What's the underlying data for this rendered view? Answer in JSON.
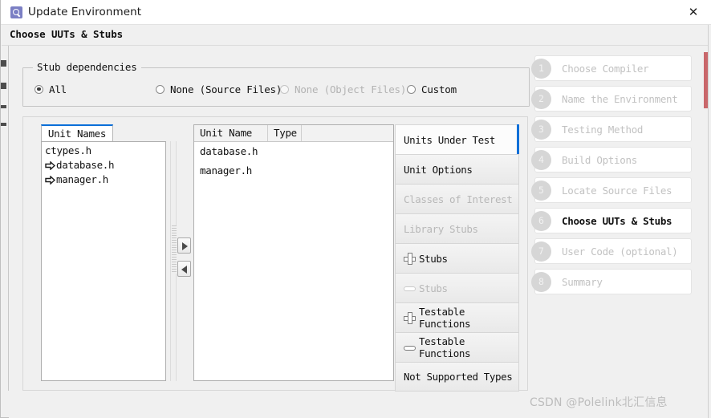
{
  "window": {
    "title": "Update Environment",
    "icon": "search-icon",
    "close_label": "✕"
  },
  "breadcrumb": {
    "text": "Choose UUTs & Stubs"
  },
  "stub_dependencies": {
    "title": "Stub dependencies",
    "options": [
      {
        "label": "All",
        "checked": true,
        "disabled": false
      },
      {
        "label": "None (Source Files)",
        "checked": false,
        "disabled": false
      },
      {
        "label": "None (Object Files)",
        "checked": false,
        "disabled": true
      },
      {
        "label": "Custom",
        "checked": false,
        "disabled": false
      }
    ]
  },
  "unit_names_panel": {
    "tab_label": "Unit Names",
    "items": [
      {
        "label": "ctypes.h",
        "arrow": false
      },
      {
        "label": "database.h",
        "arrow": true
      },
      {
        "label": "manager.h",
        "arrow": true
      }
    ]
  },
  "transfer": {
    "add_label": "▶",
    "remove_label": "◀"
  },
  "units_table": {
    "columns": [
      "Unit Name",
      "Type",
      ""
    ],
    "rows": [
      {
        "unit_name": "database.h",
        "type": ""
      },
      {
        "unit_name": "manager.h",
        "type": ""
      }
    ]
  },
  "actions": [
    {
      "label": "Units Under Test",
      "icon": "none",
      "selected": true,
      "disabled": false
    },
    {
      "label": "Unit Options",
      "icon": "none",
      "selected": false,
      "disabled": false
    },
    {
      "label": "Classes of Interest",
      "icon": "none",
      "selected": false,
      "disabled": true
    },
    {
      "label": "Library Stubs",
      "icon": "none",
      "selected": false,
      "disabled": true
    },
    {
      "label": "Stubs",
      "icon": "plus-icon",
      "selected": false,
      "disabled": false
    },
    {
      "label": "Stubs",
      "icon": "minus-icon",
      "selected": false,
      "disabled": true
    },
    {
      "label": "Testable Functions",
      "icon": "plus-icon",
      "selected": false,
      "disabled": false
    },
    {
      "label": "Testable Functions",
      "icon": "minus-icon",
      "selected": false,
      "disabled": false
    },
    {
      "label": "Not Supported Types",
      "icon": "none",
      "selected": false,
      "disabled": false
    }
  ],
  "steps": [
    {
      "num": "1",
      "label": "Choose Compiler",
      "active": false
    },
    {
      "num": "2",
      "label": "Name the Environment",
      "active": false
    },
    {
      "num": "3",
      "label": "Testing Method",
      "active": false
    },
    {
      "num": "4",
      "label": "Build Options",
      "active": false
    },
    {
      "num": "5",
      "label": "Locate Source Files",
      "active": false
    },
    {
      "num": "6",
      "label": "Choose UUTs & Stubs",
      "active": true
    },
    {
      "num": "7",
      "label": "User Code (optional)",
      "active": false
    },
    {
      "num": "8",
      "label": "Summary",
      "active": false
    }
  ],
  "watermark": {
    "text": "CSDN @Polelink北汇信息"
  },
  "colors": {
    "accent": "#0a6fd8",
    "window_bg": "#f0f0f0",
    "strip_red": "#c9676b"
  }
}
